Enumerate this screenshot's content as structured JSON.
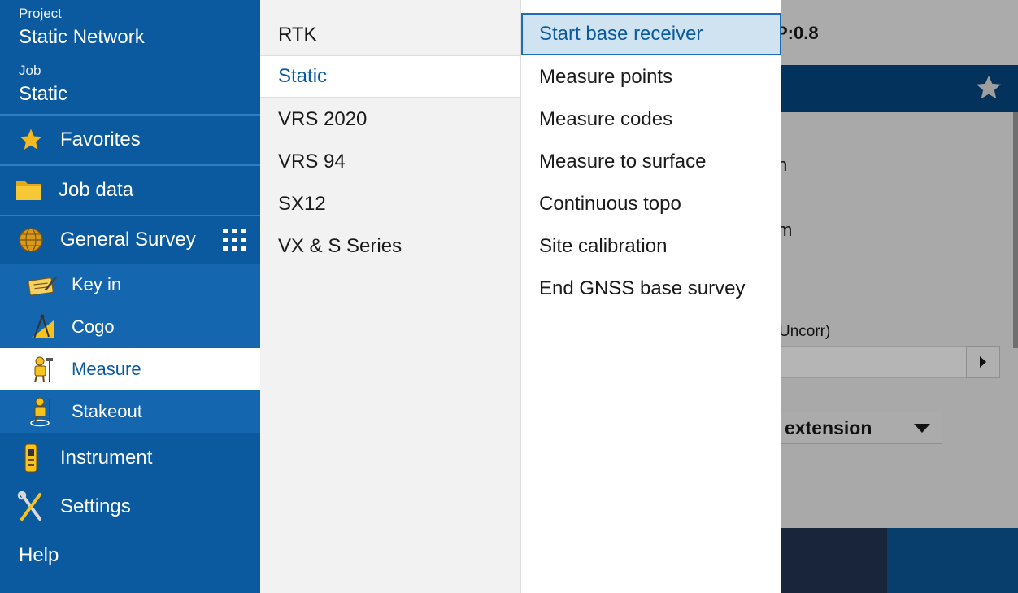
{
  "sidebar": {
    "project_caption": "Project",
    "project_name": "Static Network",
    "job_caption": "Job",
    "job_name": "Static",
    "items": [
      {
        "label": "Favorites",
        "icon": "star-icon"
      },
      {
        "label": "Job data",
        "icon": "folder-icon"
      },
      {
        "label": "General Survey",
        "icon": "globe-icon",
        "extra_icon": "app-grid-icon"
      },
      {
        "label": "Key in",
        "icon": "keyboard-pencil-icon"
      },
      {
        "label": "Cogo",
        "icon": "compass-icon"
      },
      {
        "label": "Measure",
        "icon": "surveyor-icon",
        "active": true
      },
      {
        "label": "Stakeout",
        "icon": "stakeout-surveyor-icon"
      },
      {
        "label": "Instrument",
        "icon": "gnss-receiver-icon"
      },
      {
        "label": "Settings",
        "icon": "tools-icon"
      },
      {
        "label": "Help"
      }
    ]
  },
  "styles": {
    "items": [
      "RTK",
      "Static",
      "VRS 2020",
      "VRS 94",
      "SX12",
      "VX & S Series"
    ],
    "active": "Static"
  },
  "actions": {
    "items": [
      "Start base receiver",
      "Measure points",
      "Measure codes",
      "Measure to surface",
      "Continuous topo",
      "Site calibration",
      "End GNSS base survey"
    ],
    "active": "Start base receiver"
  },
  "background": {
    "status_fragment": "P:0.8",
    "frag_1": "n",
    "frag_2": "m",
    "frag_3": "Uncorr)",
    "select_value": "extension"
  },
  "colors": {
    "sidebar": "#0b5aa0",
    "accent": "#1e6db5",
    "highlight": "#cfe3f1"
  }
}
